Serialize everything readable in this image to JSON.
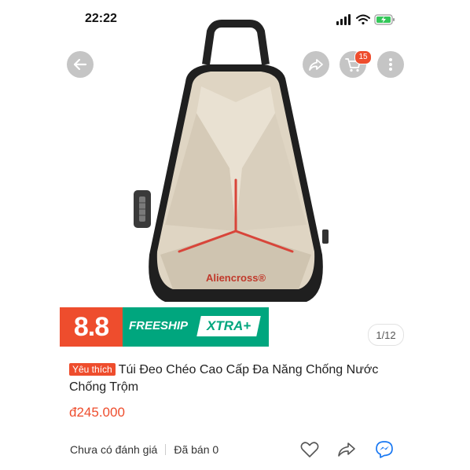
{
  "status_bar": {
    "time": "22:22"
  },
  "nav": {
    "cart_count": "15"
  },
  "product": {
    "brand_logo": "Aliencross®",
    "image_counter": "1/12",
    "promo": {
      "number": "8.8",
      "freeship": "FREESHIP",
      "xtra": "XTRA+"
    },
    "favorite_tag": "Yêu thích",
    "title": "Túi Đeo Chéo Cao Cấp Đa Năng Chống Nước Chống Trộm",
    "price": "đ245.000",
    "rating_text": "Chưa có đánh giá",
    "sold_text": "Đã bán 0"
  },
  "colors": {
    "accent": "#ee4d2d",
    "freeship_green": "#00a67e",
    "messenger": "#1877f2"
  }
}
